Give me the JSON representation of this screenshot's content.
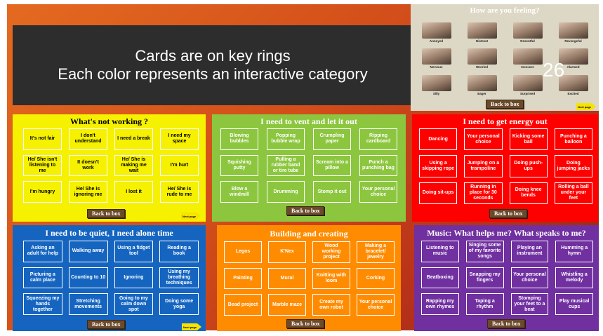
{
  "title": {
    "line1": "Cards are on key rings",
    "line2": "Each color represents an interactive category"
  },
  "page_number": "26",
  "feelings": {
    "title": "How are you feeling?",
    "labels": [
      "Annoyed",
      "Distrust",
      "Resentful",
      "Revengeful",
      "Nervous",
      "Worried",
      "Insecure",
      "Alarmed",
      "Silly",
      "Eager",
      "Surprised",
      "Excited"
    ],
    "back": "Back to box",
    "next": "Next page"
  },
  "not_working": {
    "title": "What's not working ?",
    "cards": [
      "It's not fair",
      "I don't understand",
      "I need a break",
      "I need my space",
      "He/ She isn't listening to me",
      "It doesn't work",
      "He/ She is making me wait",
      "I'm hurt",
      "I'm hungry",
      "He/ She is ignoring me",
      "I lost it",
      "He/ She is rude to me"
    ],
    "back": "Back to box",
    "next": "Next page"
  },
  "vent": {
    "title": "I need to vent and let it out",
    "cards": [
      "Blowing bubbles",
      "Popping bubble wrap",
      "Crumpling paper",
      "Ripping cardboard",
      "Squishing putty",
      "Pulling a rubber band or tire tube",
      "Scream into a pillow",
      "Punch a punching bag",
      "Blow a windmill",
      "Drumming",
      "Stomp it out",
      "Your personal choice"
    ],
    "back": "Back to box"
  },
  "energy": {
    "title": "I need to get energy out",
    "cards": [
      "Dancing",
      "Your personal choice",
      "Kicking some ball",
      "Punching a balloon",
      "Using a skipping rope",
      "Jumping on a trampoline",
      "Doing push-ups",
      "Doing jumping jacks",
      "Doing sit-ups",
      "Running in place for 30 seconds",
      "Doing knee bends",
      "Rolling a ball under your feet"
    ],
    "back": "Back to box"
  },
  "quiet": {
    "title": "I need to be quiet, I need alone time",
    "cards": [
      "Asking an adult for help",
      "Walking away",
      "Using a fidget tool",
      "Reading a book",
      "Picturing a calm place",
      "Counting to 10",
      "Ignoring",
      "Using my breathing techniques",
      "Squeezing my hands together",
      "Stretching movements",
      "Going to my calm down spot",
      "Doing some yoga"
    ],
    "back": "Back to box",
    "next": "Next page"
  },
  "build": {
    "title": "Building and creating",
    "cards": [
      "Legos",
      "K'Nex",
      "Wood working project",
      "Making a bracelet/ jewelry",
      "Painting",
      "Mural",
      "Knitting with loom",
      "Corking",
      "Bead project",
      "Marble maze",
      "Create my own robot",
      "Your personal choice"
    ],
    "back": "Back to box"
  },
  "music": {
    "title": "Music: What helps me? What speaks to me?",
    "cards": [
      "Listening to music",
      "Singing some of my favorite songs",
      "Playing an instrument",
      "Humming a hymn",
      "Beatboxing",
      "Snapping my fingers",
      "Your personal choice",
      "Whistling a melody",
      "Rapping my own rhymes",
      "Taping a rhythm",
      "Stomping your feet to a beat",
      "Play musical cups"
    ],
    "back": "Back to box"
  },
  "colors": {
    "yellow": "#f6f100",
    "green": "#8cc63f",
    "red": "#ff0000",
    "blue": "#1565c0",
    "orange": "#ff8c00",
    "purple": "#7030a0",
    "title_band": "#2d2d2d",
    "back_button": "#6b4a2b"
  }
}
